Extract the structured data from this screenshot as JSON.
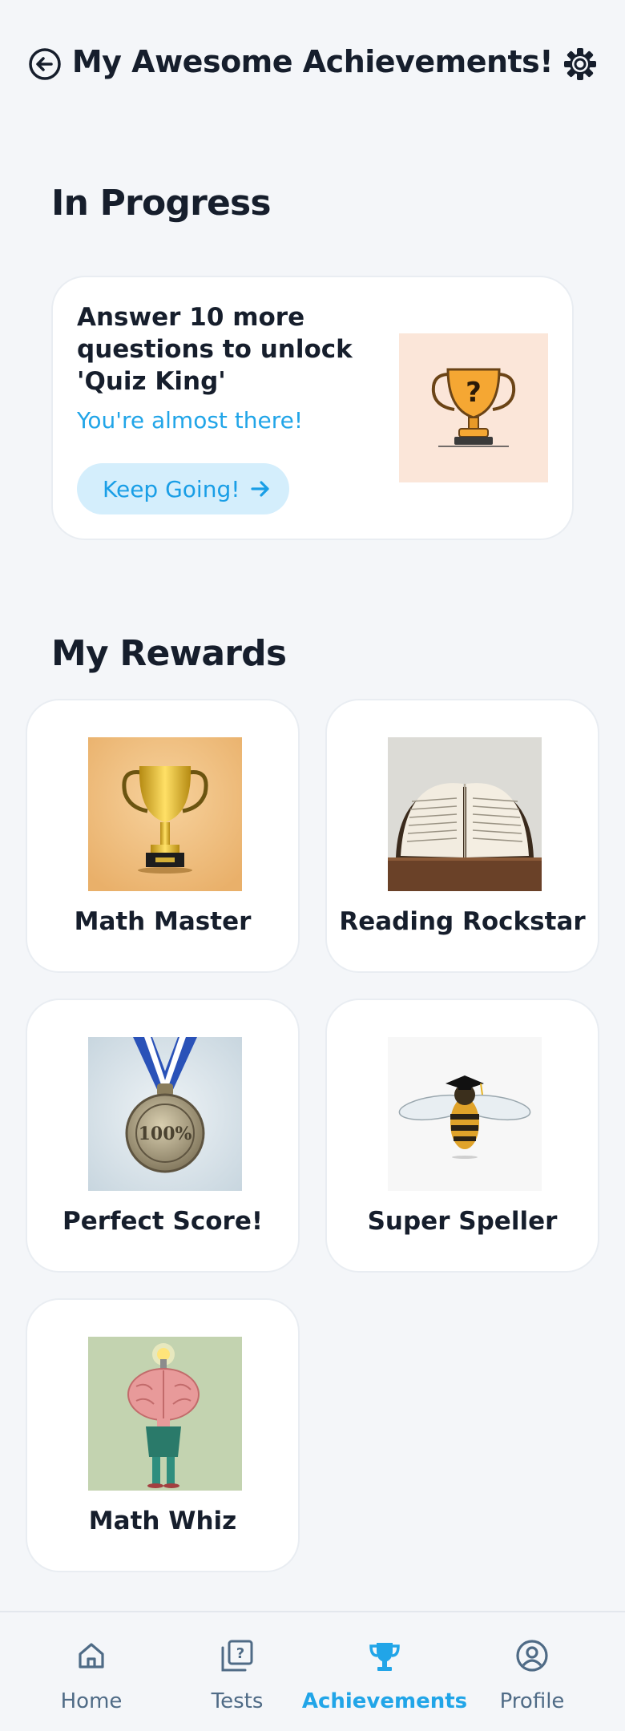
{
  "header": {
    "title": "My Awesome Achievements!",
    "back_icon": "back-arrow-circle-icon",
    "settings_icon": "gear-icon"
  },
  "in_progress": {
    "section_title": "In Progress",
    "card": {
      "message": "Answer 10 more questions to unlock 'Quiz King'",
      "encouragement": "You're almost there!",
      "button_label": "Keep Going!",
      "button_icon": "arrow-right-icon",
      "image": "trophy-question-mark-icon"
    }
  },
  "rewards": {
    "section_title": "My Rewards",
    "items": [
      {
        "label": "Math Master",
        "image": "gold-trophy-image"
      },
      {
        "label": "Reading Rockstar",
        "image": "open-book-image"
      },
      {
        "label": "Perfect Score!",
        "image": "medal-100-image"
      },
      {
        "label": "Super Speller",
        "image": "bee-graduation-cap-image"
      },
      {
        "label": "Math Whiz",
        "image": "brain-lightbulb-character-image"
      }
    ]
  },
  "bottom_nav": {
    "items": [
      {
        "label": "Home",
        "icon": "home-icon",
        "active": false
      },
      {
        "label": "Tests",
        "icon": "tests-quiz-icon",
        "active": false
      },
      {
        "label": "Achievements",
        "icon": "trophy-icon",
        "active": true
      },
      {
        "label": "Profile",
        "icon": "user-circle-icon",
        "active": false
      }
    ]
  },
  "colors": {
    "accent": "#21a5e8",
    "background": "#f4f6f9",
    "card": "#ffffff",
    "text": "#161e2c",
    "nav_inactive": "#4f6b86"
  }
}
